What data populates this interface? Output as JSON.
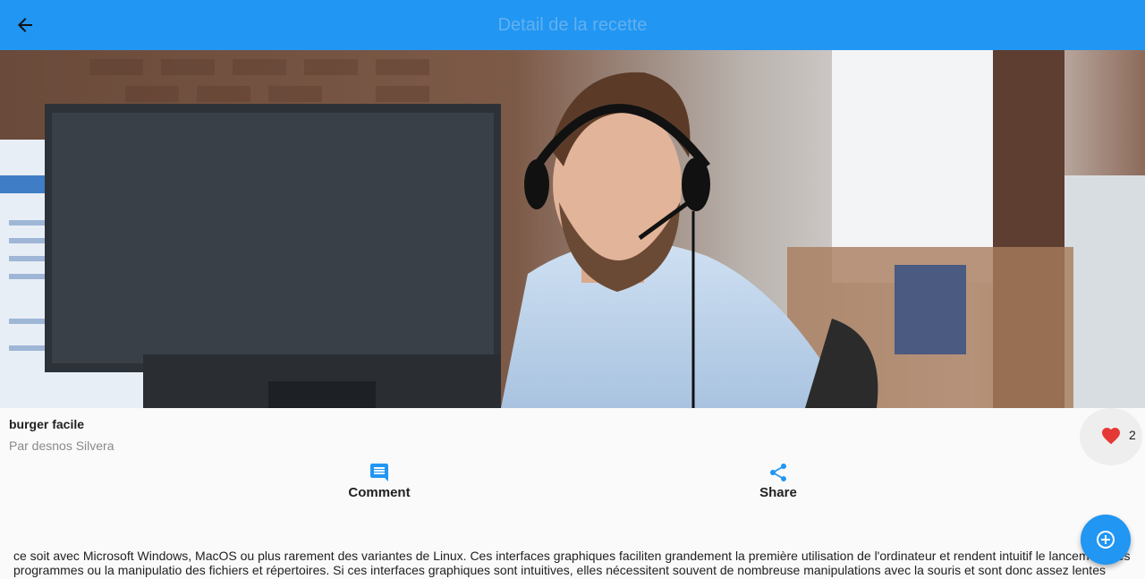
{
  "appbar": {
    "title": "Detail de la recette",
    "back_icon": "arrow-back-icon"
  },
  "hero": {
    "image": "man-with-headset-at-computer-photo"
  },
  "recipe": {
    "title": "burger facile",
    "author": "Par desnos Silvera",
    "likes": "2"
  },
  "actions": {
    "comment": {
      "label": "Comment",
      "icon": "comment-icon"
    },
    "share": {
      "label": "Share",
      "icon": "share-icon"
    }
  },
  "description": "ce soit avec Microsoft Windows, MacOS ou plus rarement des variantes de Linux. Ces interfaces graphiques faciliten grandement la première utilisation de l'ordinateur et rendent intuitif le lancement des programmes ou la manipulatio des fichiers et répertoires. Si ces interfaces graphiques sont intuitives, elles nécessitent souvent de nombreuse manipulations avec la souris et sont donc assez lentes",
  "fab": {
    "icon": "add-circle-icon"
  },
  "colors": {
    "primary": "#2196f3",
    "like": "#e53935"
  }
}
